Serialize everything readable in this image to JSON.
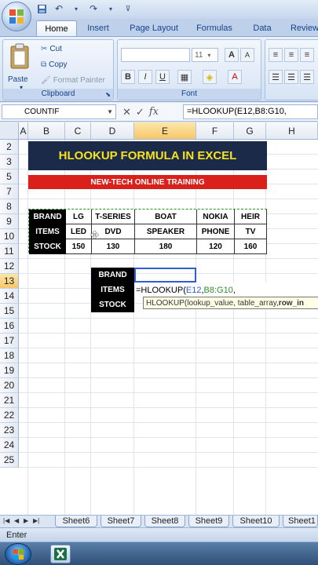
{
  "qat": {
    "save_icon": "save-icon",
    "undo_icon": "undo-icon",
    "redo_icon": "redo-icon"
  },
  "tabs": [
    {
      "label": "Home"
    },
    {
      "label": "Insert"
    },
    {
      "label": "Page Layout"
    },
    {
      "label": "Formulas"
    },
    {
      "label": "Data"
    },
    {
      "label": "Review"
    }
  ],
  "ribbon": {
    "clipboard": {
      "paste": "Paste",
      "cut": "Cut",
      "copy": "Copy",
      "format_painter": "Format Painter",
      "label": "Clipboard"
    },
    "font": {
      "size": "11",
      "bold": "B",
      "italic": "I",
      "underline": "U",
      "font_color": "A",
      "grow": "A",
      "shrink": "A",
      "label": "Font"
    }
  },
  "formula_bar": {
    "name_box": "COUNTIF",
    "cancel": "✕",
    "enter": "✓",
    "fx": "fx",
    "formula": "=HLOOKUP(E12,B8:G10,"
  },
  "columns": [
    "A",
    "B",
    "C",
    "D",
    "E",
    "F",
    "G",
    "H"
  ],
  "rows": [
    "2",
    "3",
    "5",
    "7",
    "8",
    "9",
    "10",
    "11",
    "12",
    "13",
    "14",
    "15",
    "16",
    "17",
    "18",
    "19",
    "20",
    "21",
    "22",
    "23",
    "24",
    "25"
  ],
  "banner": {
    "title": "HLOOKUP FORMULA IN EXCEL",
    "subtitle": "NEW-TECH ONLINE TRAINING"
  },
  "table": {
    "row_headers": [
      "BRAND",
      "ITEMS",
      "STOCK"
    ],
    "brands": [
      "LG",
      "T-SERIES",
      "BOAT",
      "NOKIA",
      "HEIR"
    ],
    "items": [
      "LED",
      "DVD",
      "SPEAKER",
      "PHONE",
      "TV"
    ],
    "stock": [
      "150",
      "130",
      "180",
      "120",
      "160"
    ]
  },
  "lookup": {
    "labels": [
      "BRAND",
      "ITEMS",
      "STOCK"
    ],
    "formula_prefix": "=HLOOKUP(",
    "formula_ref1": "E12",
    "formula_sep": ",",
    "formula_ref2": "B8:G10",
    "formula_end": ",",
    "tooltip_prefix": "HLOOKUP(lookup_value, table_array, ",
    "tooltip_bold": "row_in"
  },
  "sheet_tabs": [
    "Sheet6",
    "Sheet7",
    "Sheet8",
    "Sheet9",
    "Sheet10",
    "Sheet1"
  ],
  "status": "Enter",
  "colors": {
    "banner_bg": "#1c2a4a",
    "banner_text": "#f7e21b",
    "subtitle_bg": "#d9201a",
    "header_bg": "#000000"
  }
}
